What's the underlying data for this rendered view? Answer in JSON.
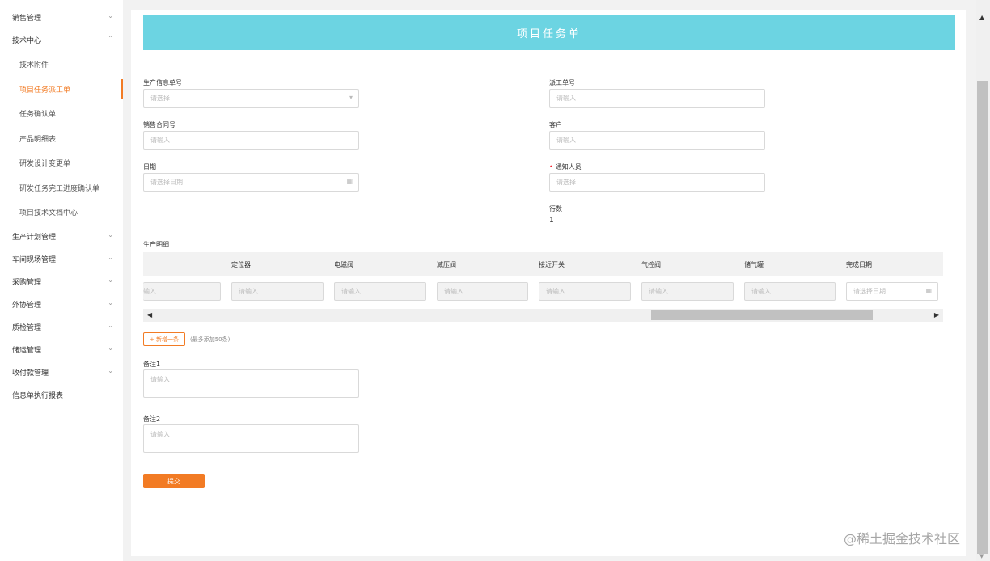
{
  "sidebar": {
    "items": [
      {
        "label": "销售管理",
        "chevron": "⌄"
      },
      {
        "label": "技术中心",
        "chevron": "⌃"
      },
      {
        "label": "技术附件"
      },
      {
        "label": "项目任务派工单"
      },
      {
        "label": "任务确认单"
      },
      {
        "label": "产品明细表"
      },
      {
        "label": "研发设计变更单"
      },
      {
        "label": "研发任务完工进度确认单"
      },
      {
        "label": "项目技术文档中心"
      },
      {
        "label": "生产计划管理",
        "chevron": "⌄"
      },
      {
        "label": "车间现场管理",
        "chevron": "⌄"
      },
      {
        "label": "采购管理",
        "chevron": "⌄"
      },
      {
        "label": "外协管理",
        "chevron": "⌄"
      },
      {
        "label": "质检管理",
        "chevron": "⌄"
      },
      {
        "label": "储运管理",
        "chevron": "⌄"
      },
      {
        "label": "收付款管理",
        "chevron": "⌄"
      },
      {
        "label": "信息单执行报表"
      }
    ]
  },
  "form": {
    "title": "项目任务单",
    "fields": {
      "production_info_no": {
        "label": "生产信息单号",
        "placeholder": "请选择"
      },
      "dispatch_no": {
        "label": "派工单号",
        "placeholder": "请输入"
      },
      "sales_contract_no": {
        "label": "销售合同号",
        "placeholder": "请输入"
      },
      "customer": {
        "label": "客户",
        "placeholder": "请输入"
      },
      "date": {
        "label": "日期",
        "placeholder": "请选择日期"
      },
      "notify_person": {
        "label": "通知人员",
        "required_mark": "•",
        "placeholder": "请选择"
      },
      "row_count": {
        "label": "行数",
        "value": "1"
      }
    },
    "production_detail": {
      "label": "生产明细",
      "columns": [
        "定位器",
        "电磁阀",
        "减压阀",
        "接近开关",
        "气控阀",
        "储气罐",
        "完成日期"
      ],
      "row": [
        "输入",
        "请输入",
        "请输入",
        "请输入",
        "请输入",
        "请输入",
        "请输入",
        "请选择日期"
      ],
      "scroll_left": "◀",
      "scroll_right": "▶"
    },
    "add_button": "+ 新增一条",
    "add_hint": "(最多添加50条)",
    "remark1": {
      "label": "备注1",
      "placeholder": "请输入"
    },
    "remark2": {
      "label": "备注2",
      "placeholder": "请输入"
    },
    "submit": "提交"
  },
  "icons": {
    "select_arrow": "▾",
    "calendar": "▦",
    "scroll_up": "▲",
    "scroll_down": "▼"
  },
  "watermark": "@稀土掘金技术社区",
  "colors": {
    "accent": "#f27b24",
    "banner": "#6cd4e2",
    "required": "#f5222d"
  }
}
